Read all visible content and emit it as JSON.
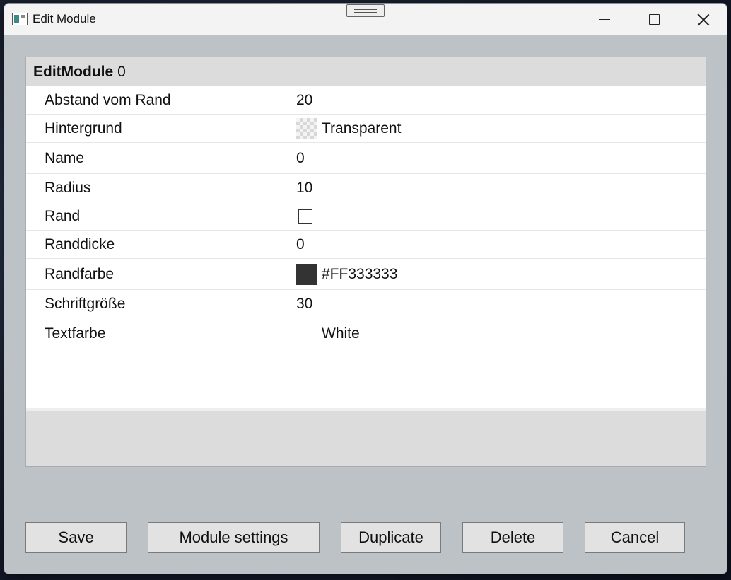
{
  "window": {
    "title": "Edit Module"
  },
  "grid": {
    "header_bold": "EditModule",
    "header_rest": "0",
    "rows": [
      {
        "name": "Abstand vom Rand",
        "value": "20"
      },
      {
        "name": "Hintergrund",
        "value": "Transparent",
        "swatch": "checker"
      },
      {
        "name": "Name",
        "value": "0"
      },
      {
        "name": "Radius",
        "value": "10"
      },
      {
        "name": "Rand",
        "checked": false
      },
      {
        "name": "Randdicke",
        "value": "0"
      },
      {
        "name": "Randfarbe",
        "value": "#FF333333",
        "swatch_color": "#333333"
      },
      {
        "name": "Schriftgröße",
        "value": "30"
      },
      {
        "name": "Textfarbe",
        "value": "White",
        "swatch_color": "#ffffff"
      }
    ]
  },
  "buttons": {
    "save": "Save",
    "module_settings": "Module settings",
    "duplicate": "Duplicate",
    "delete": "Delete",
    "cancel": "Cancel"
  },
  "icons": {
    "app": "window-app-icon",
    "minimize": "minimize-icon",
    "maximize": "maximize-icon",
    "close": "close-icon"
  }
}
